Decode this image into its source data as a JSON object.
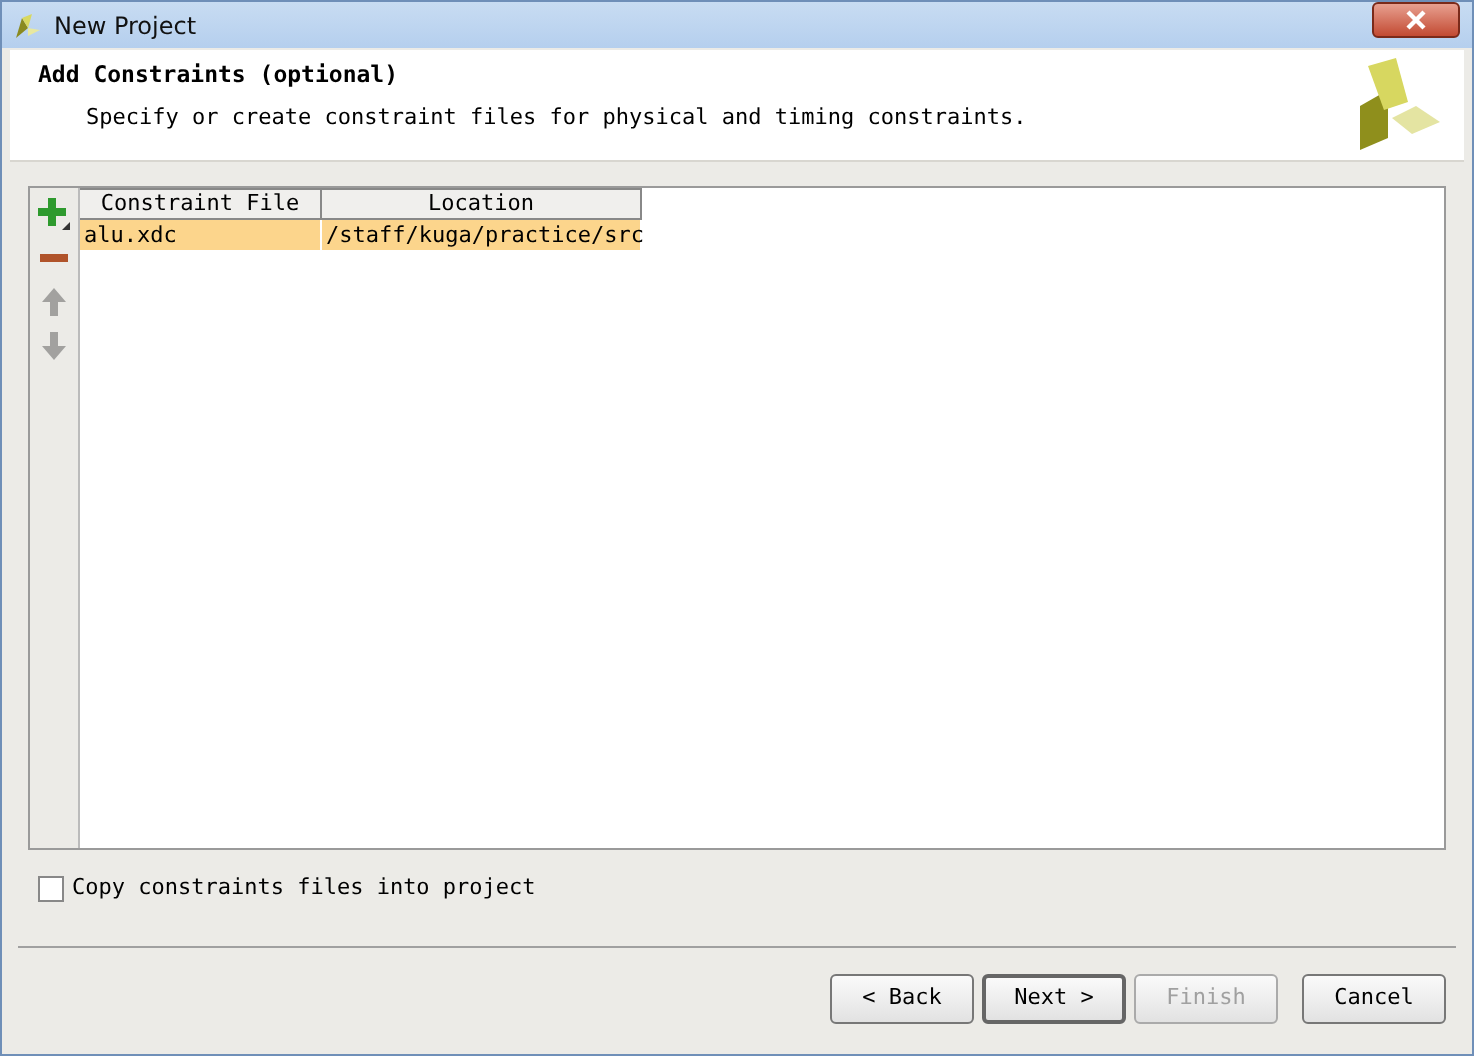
{
  "window": {
    "title": "New Project"
  },
  "header": {
    "title": "Add Constraints (optional)",
    "description": "Specify or create constraint files for physical and timing constraints."
  },
  "toolbar": [
    {
      "kind": "add",
      "disabled": false
    },
    {
      "kind": "remove",
      "disabled": false
    },
    {
      "kind": "up",
      "disabled": true
    },
    {
      "kind": "down",
      "disabled": true
    }
  ],
  "table": {
    "columns": [
      "Constraint File",
      "Location"
    ],
    "rows": [
      {
        "cells": [
          "alu.xdc",
          "/staff/kuga/practice/src"
        ],
        "selected": true
      }
    ]
  },
  "copy_option": {
    "label": "Copy constraints files into project",
    "checked": false
  },
  "buttons": [
    {
      "label": "< Back",
      "disabled": false,
      "default": false
    },
    {
      "label": "Next >",
      "disabled": false,
      "default": true
    },
    {
      "label": "Finish",
      "disabled": true,
      "default": false
    },
    {
      "label": "Cancel",
      "disabled": false,
      "default": false
    }
  ]
}
